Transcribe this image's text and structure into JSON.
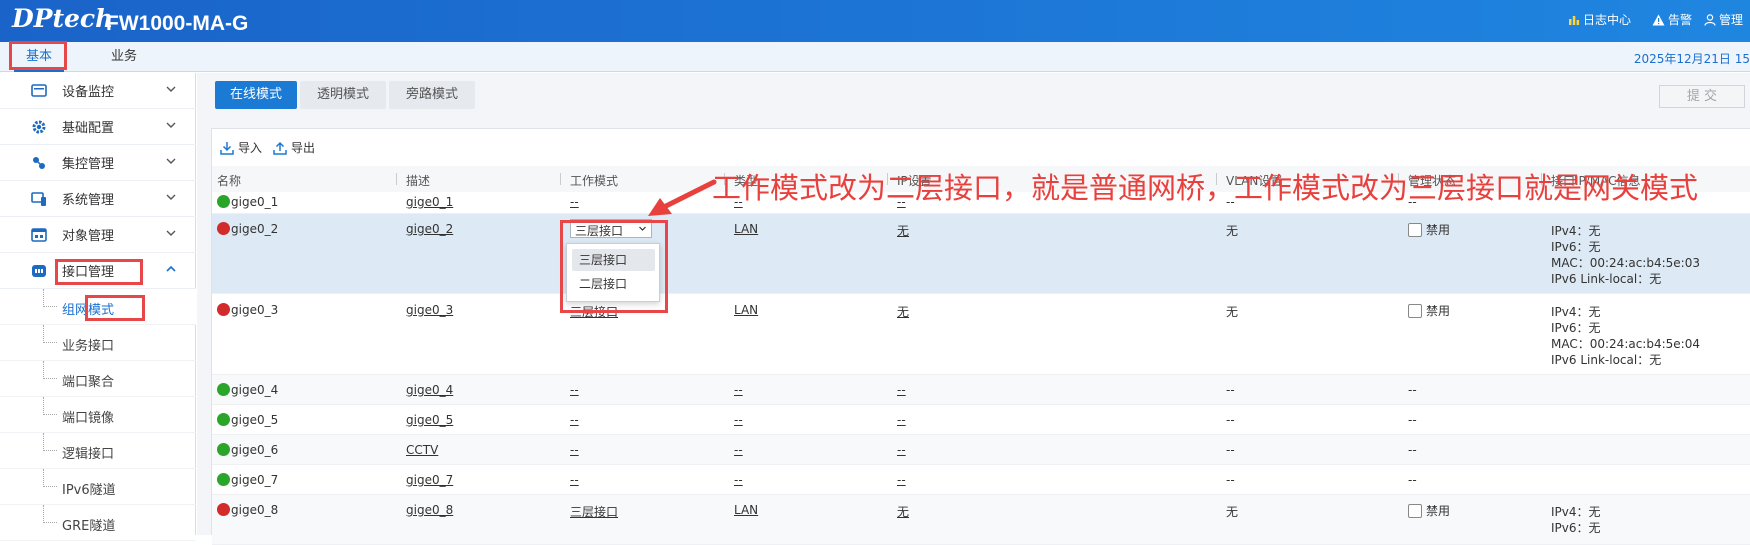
{
  "header": {
    "logo": "DPtech",
    "product": "FW1000-MA-G",
    "links": [
      "日志中心",
      "告警",
      "管理"
    ]
  },
  "nav": {
    "tabs": [
      "基本",
      "业务"
    ],
    "date": "2025年12月21日 15"
  },
  "sidebar": {
    "menus": [
      {
        "label": "设备监控",
        "icon": "monitor-icon"
      },
      {
        "label": "基础配置",
        "icon": "gear-icon"
      },
      {
        "label": "集控管理",
        "icon": "network-icon"
      },
      {
        "label": "系统管理",
        "icon": "computer-icon"
      },
      {
        "label": "对象管理",
        "icon": "grid-icon"
      },
      {
        "label": "接口管理",
        "icon": "interface-icon"
      }
    ],
    "submenus": [
      "组网模式",
      "业务接口",
      "端口聚合",
      "端口镜像",
      "逻辑接口",
      "IPv6隧道",
      "GRE隧道"
    ]
  },
  "main": {
    "mode_tabs": [
      "在线模式",
      "透明模式",
      "旁路模式"
    ],
    "submit": "提 交",
    "toolbar": {
      "import": "导入",
      "export": "导出"
    },
    "columns": [
      "名称",
      "描述",
      "工作模式",
      "类型",
      "IP设置",
      "VLAN设置",
      "管理状态",
      "接口IP/MAC信息"
    ],
    "rows": [
      {
        "name": "gige0_1",
        "status": "up",
        "desc": "gige0_1",
        "mode": "--",
        "type": "--",
        "ip": "--",
        "vlan": "--",
        "admin": "--",
        "info": []
      },
      {
        "name": "gige0_2",
        "status": "down",
        "desc": "gige0_2",
        "mode": "三层接口",
        "type": "LAN",
        "ip": "无",
        "vlan": "无",
        "admin": "禁用",
        "info": [
          "IPv4：无",
          "IPv6：无",
          "MAC：00:24:ac:b4:5e:03",
          "IPv6 Link-local：无"
        ]
      },
      {
        "name": "gige0_3",
        "status": "down",
        "desc": "gige0_3",
        "mode": "三层接口",
        "type": "LAN",
        "ip": "无",
        "vlan": "无",
        "admin": "禁用",
        "info": [
          "IPv4：无",
          "IPv6：无",
          "MAC：00:24:ac:b4:5e:04",
          "IPv6 Link-local：无"
        ]
      },
      {
        "name": "gige0_4",
        "status": "up",
        "desc": "gige0_4",
        "mode": "--",
        "type": "--",
        "ip": "--",
        "vlan": "--",
        "admin": "--",
        "info": []
      },
      {
        "name": "gige0_5",
        "status": "up",
        "desc": "gige0_5",
        "mode": "--",
        "type": "--",
        "ip": "--",
        "vlan": "--",
        "admin": "--",
        "info": []
      },
      {
        "name": "gige0_6",
        "status": "up",
        "desc": "CCTV",
        "mode": "--",
        "type": "--",
        "ip": "--",
        "vlan": "--",
        "admin": "--",
        "info": []
      },
      {
        "name": "gige0_7",
        "status": "up",
        "desc": "gige0_7",
        "mode": "--",
        "type": "--",
        "ip": "--",
        "vlan": "--",
        "admin": "--",
        "info": []
      },
      {
        "name": "gige0_8",
        "status": "down",
        "desc": "gige0_8",
        "mode": "三层接口",
        "type": "LAN",
        "ip": "无",
        "vlan": "无",
        "admin": "禁用",
        "info": [
          "IPv4：无",
          "IPv6：无"
        ]
      }
    ],
    "dropdown": {
      "selected": "三层接口",
      "options": [
        "三层接口",
        "二层接口"
      ]
    }
  },
  "annotation": "工作模式改为二层接口，就是普通网桥，工作模式改为三层接口就是网关模式",
  "colors": {
    "accent": "#1a7ad4",
    "highlight": "#e8474a",
    "status_up": "#2aa52a",
    "status_down": "#d22b2b"
  }
}
